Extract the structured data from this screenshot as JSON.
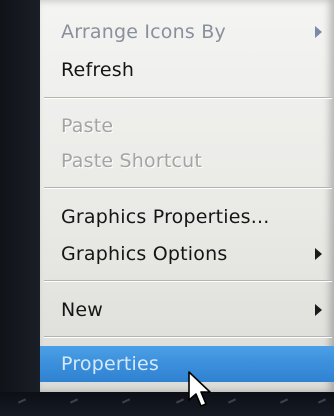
{
  "menu": {
    "items": [
      {
        "label": "Arrange Icons By",
        "state": "enabled",
        "submenu": true
      },
      {
        "label": "Refresh",
        "state": "enabled",
        "submenu": false
      },
      {
        "label": "Paste",
        "state": "disabled",
        "submenu": false
      },
      {
        "label": "Paste Shortcut",
        "state": "disabled",
        "submenu": false
      },
      {
        "label": "Graphics Properties...",
        "state": "enabled",
        "submenu": false
      },
      {
        "label": "Graphics Options",
        "state": "enabled",
        "submenu": true
      },
      {
        "label": "New",
        "state": "enabled",
        "submenu": true
      },
      {
        "label": "Properties",
        "state": "highlighted",
        "submenu": false
      }
    ]
  },
  "colors": {
    "menu_background": "#f0f0ee",
    "highlight": "#3b8fdb",
    "disabled_text": "#a4a4a4",
    "separator": "#b4b4b0"
  },
  "icons": {
    "submenu_arrow": "chevron-right-icon",
    "pointer": "mouse-cursor-icon"
  }
}
